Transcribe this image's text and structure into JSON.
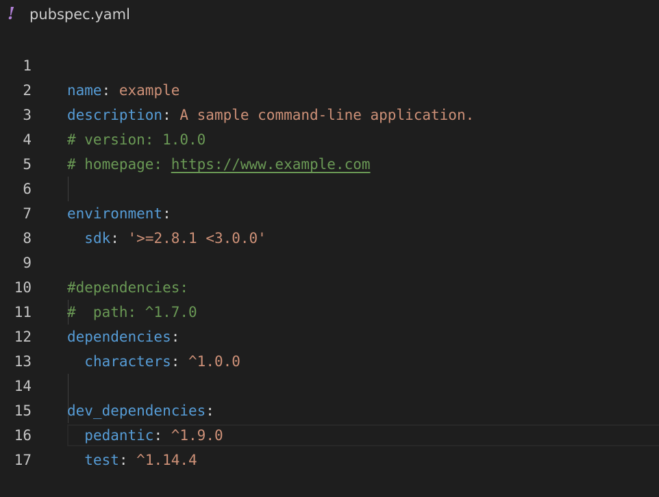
{
  "tab": {
    "icon_glyph": "!",
    "icon_color": "#b180d7",
    "filename": "pubspec.yaml"
  },
  "editor": {
    "lines": [
      {
        "num": "1",
        "key": "name",
        "sep": ": ",
        "value": "example"
      },
      {
        "num": "2",
        "key": "description",
        "sep": ": ",
        "value": "A sample command-line application."
      },
      {
        "num": "3",
        "comment": "# version: 1.0.0"
      },
      {
        "num": "4",
        "comment_prefix": "# homepage: ",
        "link": "https://www.example.com"
      },
      {
        "num": "5"
      },
      {
        "num": "6",
        "key": "environment",
        "sep": ":"
      },
      {
        "num": "7",
        "indent": "  ",
        "key": "sdk",
        "sep": ": ",
        "value": "'>=2.8.1 <3.0.0'"
      },
      {
        "num": "8"
      },
      {
        "num": "9",
        "comment": "#dependencies:"
      },
      {
        "num": "10",
        "comment": "#  path: ^1.7.0"
      },
      {
        "num": "11",
        "key": "dependencies",
        "sep": ":"
      },
      {
        "num": "12",
        "indent": "  ",
        "key": "characters",
        "sep": ": ",
        "value": "^1.0.0"
      },
      {
        "num": "13"
      },
      {
        "num": "14",
        "key": "dev_dependencies",
        "sep": ":"
      },
      {
        "num": "15",
        "indent": "  ",
        "key": "pedantic",
        "sep": ": ",
        "value": "^1.9.0"
      },
      {
        "num": "16",
        "indent": "  ",
        "key": "test",
        "sep": ": ",
        "value": "^1.14.4"
      },
      {
        "num": "17"
      }
    ]
  },
  "colors": {
    "background": "#1e1e1e",
    "key": "#569cd6",
    "string": "#ce9178",
    "comment": "#6a9955",
    "line_number": "#c6c6c6"
  }
}
